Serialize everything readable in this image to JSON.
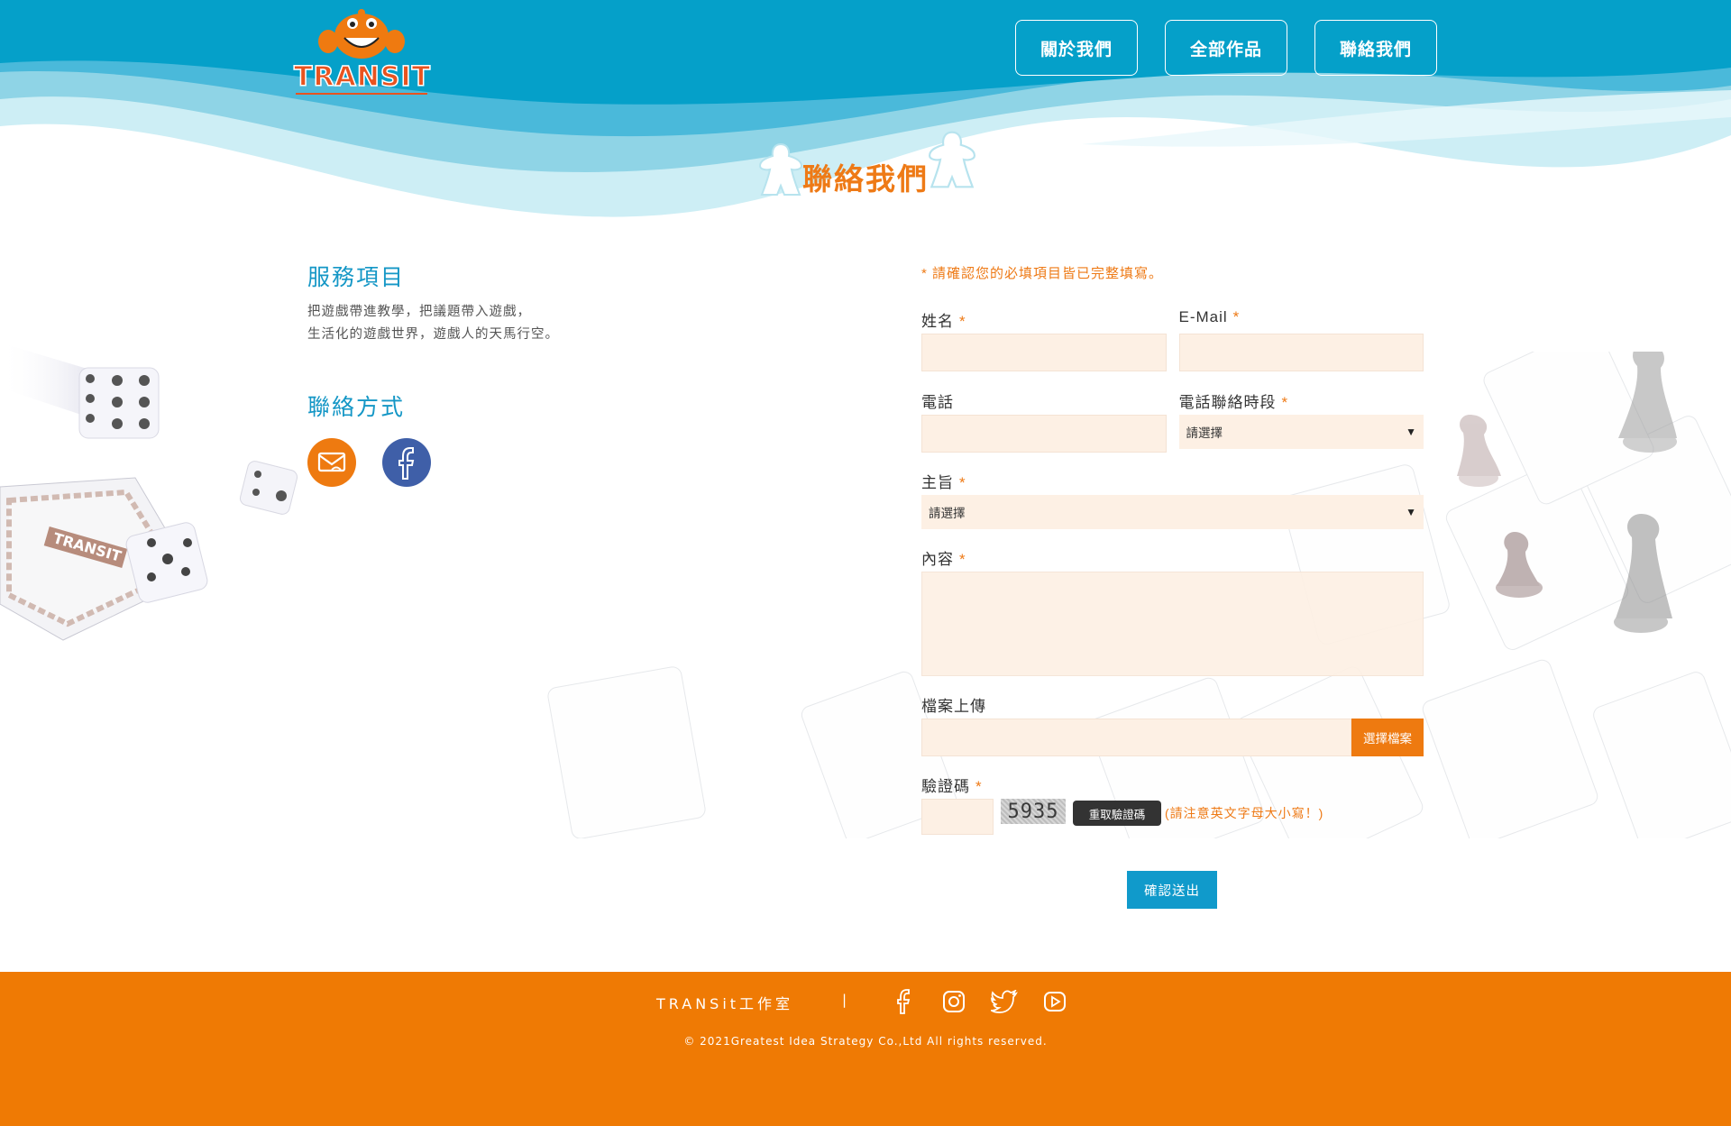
{
  "header": {
    "logo_text": "TRANSIT",
    "nav": [
      "關於我們",
      "全部作品",
      "聯絡我們"
    ]
  },
  "page_title": "聯絡我們",
  "services": {
    "title": "服務項目",
    "lines": [
      "把遊戲帶進教學，把議題帶入遊戲，",
      "生活化的遊戲世界，遊戲人的天馬行空。"
    ]
  },
  "contact": {
    "title": "聯絡方式"
  },
  "form": {
    "notice": "* 請確認您的必填項目皆已完整填寫。",
    "required_mark": "*",
    "name_label": "姓名",
    "email_label": "E-Mail",
    "phone_label": "電話",
    "period_label": "電話聯絡時段",
    "period_value": "請選擇",
    "subject_label": "主旨",
    "subject_value": "請選擇",
    "content_label": "內容",
    "upload_label": "檔案上傳",
    "upload_button": "選擇檔案",
    "captcha_label": "驗證碼",
    "captcha_code": "5935",
    "refresh_button": "重取驗證碼",
    "captcha_note": "(請注意英文字母大小寫！)",
    "submit_button": "確認送出",
    "select_caret": "▼"
  },
  "deco": {
    "board_text": "TRANSIT"
  },
  "footer": {
    "brand": "TRANSit工作室",
    "separator": "|",
    "copyright": "© 2021Greatest Idea Strategy Co.,Ltd All rights reserved."
  },
  "colors": {
    "header_blue": "#05a0c9",
    "accent_orange": "#ee7a10",
    "submit_blue": "#109acb",
    "field_bg": "#fdf0e4",
    "facebook_blue": "#3f5fa8"
  }
}
